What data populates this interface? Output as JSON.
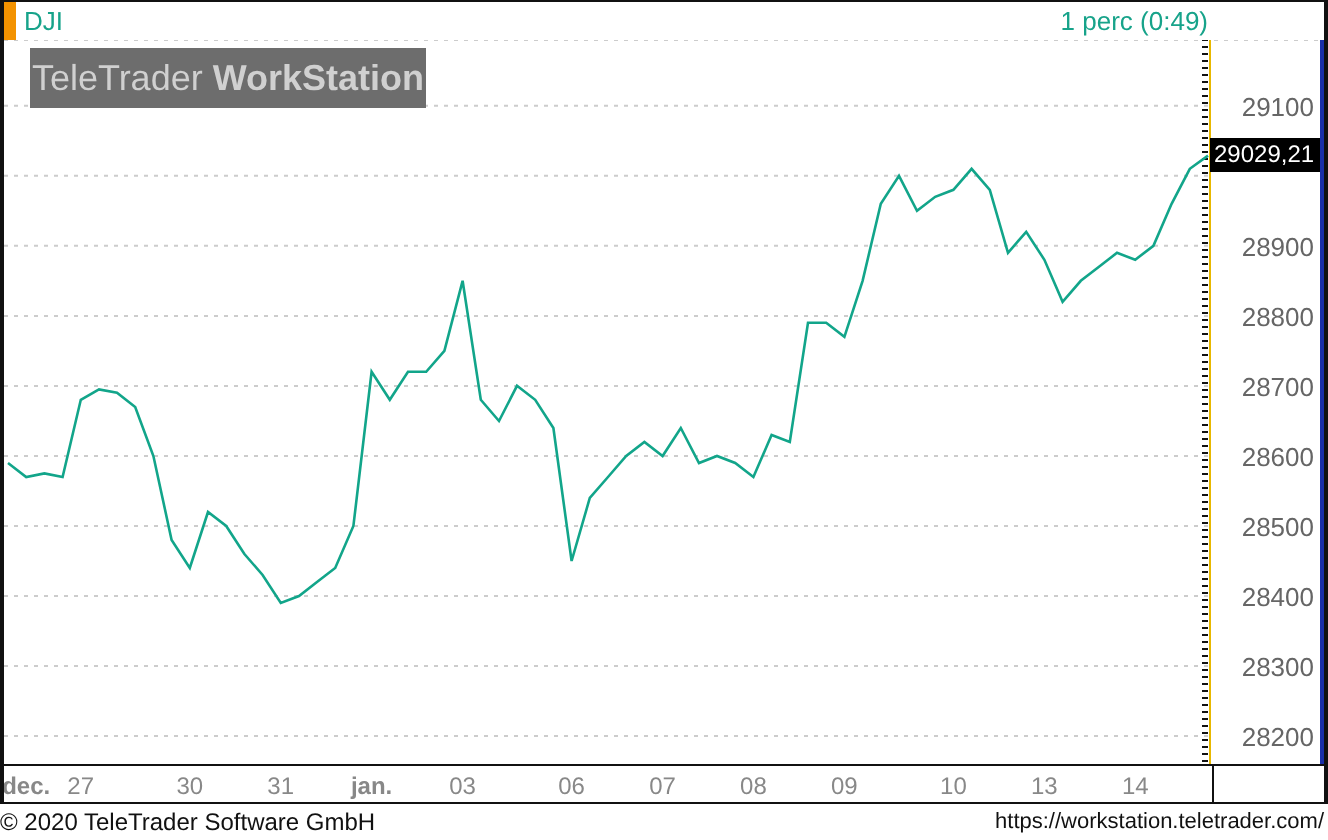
{
  "header": {
    "interval": "1 perc (0:49)"
  },
  "logo": {
    "regular": "TeleTrader",
    "bold": "WorkStation"
  },
  "chart": {
    "last_price": "29029,21",
    "chart_data": {
      "type": "line",
      "grid": true,
      "ylim": [
        28160,
        29194
      ],
      "categories": [
        null,
        "dec.",
        null,
        null,
        "27",
        null,
        null,
        null,
        null,
        null,
        "30",
        null,
        null,
        null,
        null,
        "31",
        null,
        null,
        null,
        null,
        "jan.",
        null,
        null,
        null,
        null,
        "03",
        null,
        null,
        null,
        null,
        null,
        "06",
        null,
        null,
        null,
        null,
        "07",
        null,
        null,
        null,
        null,
        "08",
        null,
        null,
        null,
        null,
        "09",
        null,
        null,
        null,
        null,
        null,
        "10",
        null,
        null,
        null,
        null,
        "13",
        null,
        null,
        null,
        null,
        "14",
        null,
        null,
        null,
        null
      ],
      "series": [
        {
          "name": "DJI",
          "color": "#12a58a",
          "values": [
            28590,
            28570,
            28575,
            28570,
            28680,
            28695,
            28690,
            28670,
            28600,
            28480,
            28440,
            28520,
            28500,
            28460,
            28430,
            28390,
            28400,
            28420,
            28440,
            28500,
            28720,
            28680,
            28720,
            28720,
            28750,
            28850,
            28680,
            28650,
            28700,
            28680,
            28640,
            28450,
            28540,
            28570,
            28600,
            28620,
            28600,
            28640,
            28590,
            28600,
            28590,
            28570,
            28630,
            28620,
            28790,
            28790,
            28770,
            28850,
            28960,
            29000,
            28950,
            28970,
            28980,
            29010,
            28980,
            28890,
            28920,
            28880,
            28820,
            28850,
            28870,
            28890,
            28880,
            28900,
            28960,
            29010,
            29029
          ]
        }
      ],
      "yticks": [
        28200,
        28300,
        28400,
        28500,
        28600,
        28700,
        28800,
        28900,
        29100
      ]
    }
  },
  "footer": {
    "copyright": "© 2020 TeleTrader Software GmbH",
    "url": "https://workstation.teletrader.com/"
  }
}
